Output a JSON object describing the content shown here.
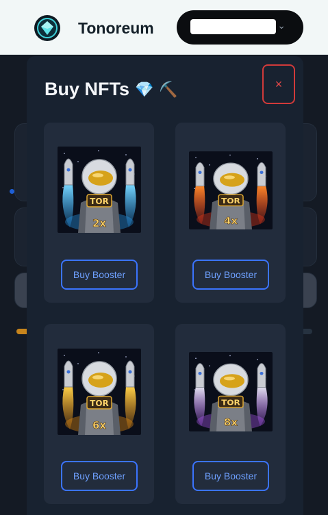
{
  "header": {
    "brand": "Tonoreum",
    "logo_icon": "tonoreum-logo-icon",
    "wallet_chevron": "⌄"
  },
  "modal": {
    "title": "Buy NFTs",
    "title_emojis": [
      "💎",
      "⛏️"
    ],
    "close_label": "×"
  },
  "boosters": [
    {
      "multiplier": "2x",
      "badge": "TOR",
      "flame": "#2aa7ff",
      "flame2": "#7ad8ff",
      "button": "Buy Booster"
    },
    {
      "multiplier": "4x",
      "badge": "TOR",
      "flame": "#ff3b1a",
      "flame2": "#ff8a2a",
      "button": "Buy Booster"
    },
    {
      "multiplier": "6x",
      "badge": "TOR",
      "flame": "#ff9a12",
      "flame2": "#ffd24a",
      "button": "Buy Booster"
    },
    {
      "multiplier": "8x",
      "badge": "TOR",
      "flame": "#b85cff",
      "flame2": "#e6e6f2",
      "button": "Buy Booster"
    }
  ],
  "colors": {
    "accent": "#3b74ff",
    "close": "#d13a3a",
    "modal_bg": "#182230",
    "card_bg": "#222c3c"
  }
}
